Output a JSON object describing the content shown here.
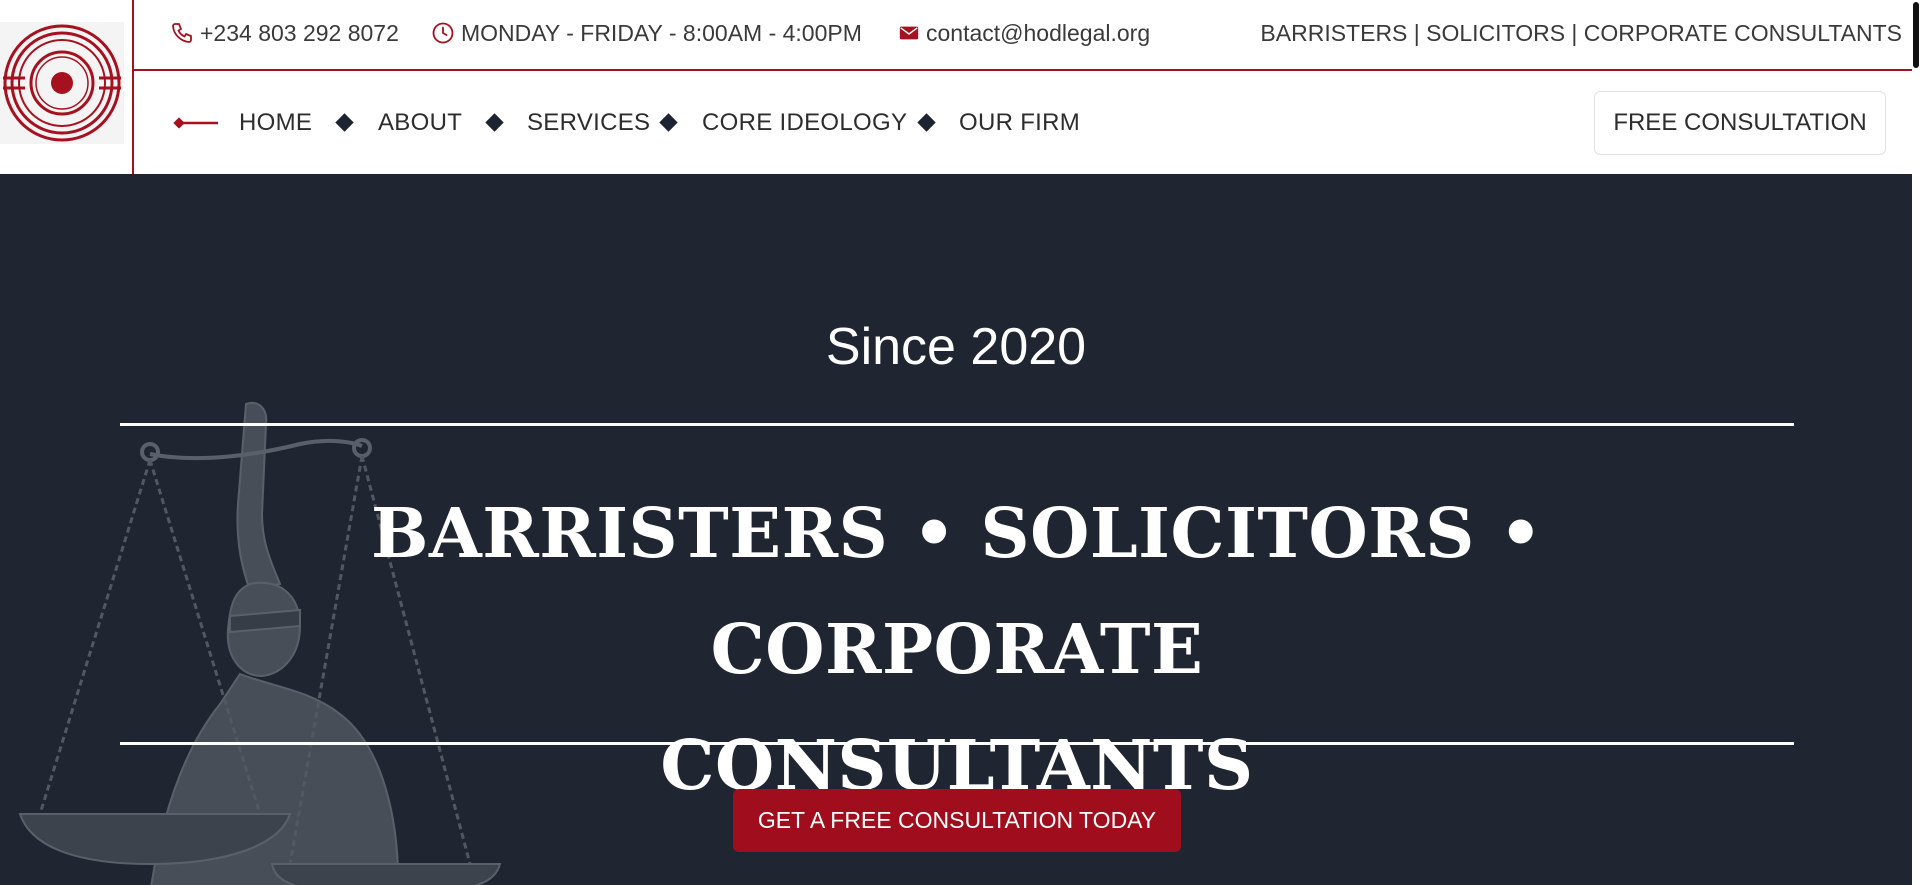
{
  "brand": {
    "accent": "#a6111f",
    "dark": "#1f2631",
    "logo_icon": "concentric-circles-logo"
  },
  "topbar": {
    "phone": {
      "icon": "phone-icon",
      "text": "+234 803 292 8072"
    },
    "hours": {
      "icon": "clock-icon",
      "text": "MONDAY - FRIDAY - 8:00AM - 4:00PM"
    },
    "email": {
      "icon": "mail-icon",
      "text": "contact@hodlegal.org"
    },
    "tagline": "BARRISTERS | SOLICITORS | CORPORATE CONSULTANTS"
  },
  "nav": {
    "items": [
      {
        "label": "HOME"
      },
      {
        "label": "ABOUT"
      },
      {
        "label": "SERVICES"
      },
      {
        "label": "CORE IDEOLOGY"
      },
      {
        "label": "OUR FIRM"
      }
    ],
    "cta_label": "FREE CONSULTATION"
  },
  "hero": {
    "since": "Since 2020",
    "headline_line1": "BARRISTERS • SOLICITORS • CORPORATE",
    "headline_line2": "CONSULTANTS",
    "cta_label": "GET A FREE CONSULTATION TODAY",
    "background_image": "lady-justice-statue"
  }
}
